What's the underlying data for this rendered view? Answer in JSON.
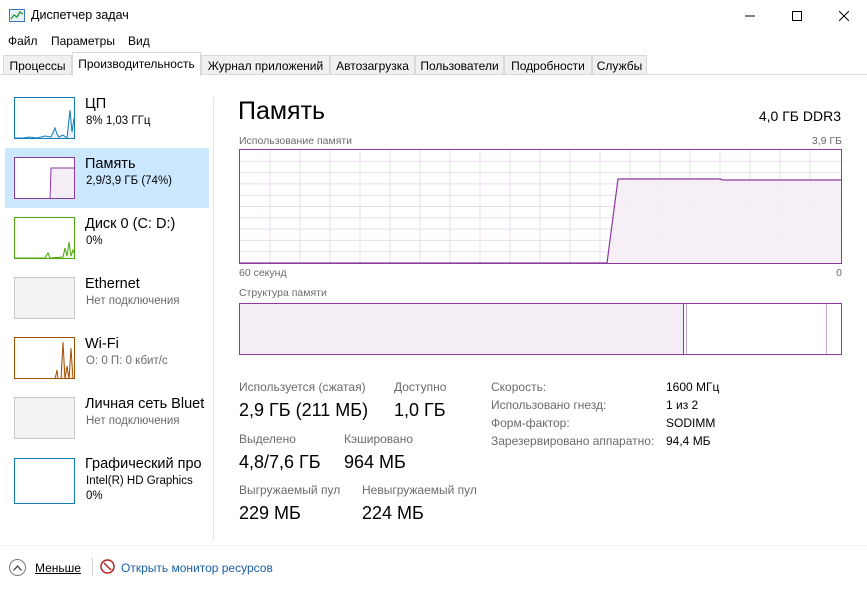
{
  "window": {
    "title": "Диспетчер задач"
  },
  "menu": [
    "Файл",
    "Параметры",
    "Вид"
  ],
  "tabs": [
    "Процессы",
    "Производительность",
    "Журнал приложений",
    "Автозагрузка",
    "Пользователи",
    "Подробности",
    "Службы"
  ],
  "active_tab": "Производительность",
  "sidebar": {
    "items": [
      {
        "title": "ЦП",
        "sub": "8% 1,03 ГГц",
        "icon": "cpu-graph"
      },
      {
        "title": "Память",
        "sub": "2,9/3,9 ГБ (74%)",
        "icon": "memory-graph",
        "selected": true
      },
      {
        "title": "Диск 0 (C: D:)",
        "sub": "0%",
        "icon": "disk-graph"
      },
      {
        "title": "Ethernet",
        "sub": "Нет подключения",
        "icon": "ethernet-graph"
      },
      {
        "title": "Wi-Fi",
        "sub": "О: 0 П: 0 кбит/с",
        "icon": "wifi-graph"
      },
      {
        "title": "Личная сеть Bluet",
        "sub": "Нет подключения",
        "icon": "bluetooth-graph"
      },
      {
        "title": "Графический про",
        "sub": "Intel(R) HD Graphics",
        "sub2": "0%",
        "icon": "gpu-graph"
      }
    ]
  },
  "main": {
    "title": "Память",
    "spec": "4,0 ГБ DDR3",
    "usage_label": "Использование памяти",
    "usage_max": "3,9 ГБ",
    "time_left": "60 секунд",
    "time_right": "0",
    "structure_label": "Структура памяти",
    "stats": {
      "in_use_label": "Используется (сжатая)",
      "in_use_value": "2,9 ГБ (211 МБ)",
      "available_label": "Доступно",
      "available_value": "1,0 ГБ",
      "committed_label": "Выделено",
      "committed_value": "4,8/7,6 ГБ",
      "cached_label": "Кэшировано",
      "cached_value": "964 МБ",
      "paged_label": "Выгружаемый пул",
      "paged_value": "229 МБ",
      "nonpaged_label": "Невыгружаемый пул",
      "nonpaged_value": "224 МБ"
    },
    "info": {
      "speed_label": "Скорость:",
      "speed_value": "1600 МГц",
      "slots_label": "Использовано гнезд:",
      "slots_value": "1 из 2",
      "form_label": "Форм-фактор:",
      "form_value": "SODIMM",
      "reserved_label": "Зарезервировано аппаратно:",
      "reserved_value": "94,4 МБ"
    }
  },
  "footer": {
    "fewer_label": "Меньше",
    "resource_monitor_label": "Открыть монитор ресурсов"
  },
  "colors": {
    "memory_accent": "#8b3a9e",
    "memory_fill": "#f4edf5",
    "cpu_accent": "#117dbb",
    "disk_accent": "#4da60c",
    "wifi_accent": "#a74f01",
    "selected_bg": "#cce8ff",
    "link": "#1a5fa8"
  }
}
